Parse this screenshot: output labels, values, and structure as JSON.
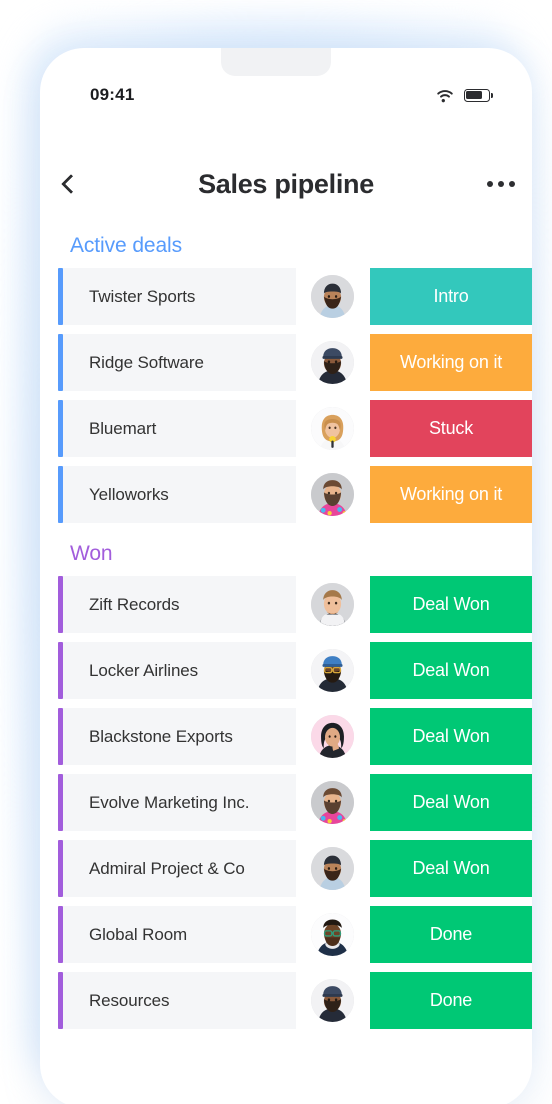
{
  "statusbar": {
    "time": "09:41",
    "wifi_icon": "wifi-icon",
    "battery_icon": "battery-icon"
  },
  "header": {
    "back_icon": "chevron-left-icon",
    "title": "Sales pipeline",
    "more_icon": "ellipsis-icon"
  },
  "colors": {
    "active_group": "#579bfc",
    "won_group": "#a25ddc",
    "status_intro": "#33c8bc",
    "status_working": "#fdab3d",
    "status_stuck": "#e2445c",
    "status_done": "#00c875",
    "row_background": "#f5f6f8",
    "text": "#333333"
  },
  "groups": [
    {
      "name": "Active deals",
      "accent": "blue",
      "rows": [
        {
          "name": "Twister Sports",
          "status": "Intro",
          "status_color": "#33c8bc",
          "avatar": "avatar-man-turban-beard"
        },
        {
          "name": "Ridge Software",
          "status": "Working on it",
          "status_color": "#fdab3d",
          "avatar": "avatar-man-cap-beard"
        },
        {
          "name": "Bluemart",
          "status": "Stuck",
          "status_color": "#e2445c",
          "avatar": "avatar-woman-blonde-mic"
        },
        {
          "name": "Yelloworks",
          "status": "Working on it",
          "status_color": "#fdab3d",
          "avatar": "avatar-man-beard-floral"
        }
      ]
    },
    {
      "name": "Won",
      "accent": "purple",
      "rows": [
        {
          "name": "Zift Records",
          "status": "Deal Won",
          "status_color": "#00c875",
          "avatar": "avatar-man-short-hair"
        },
        {
          "name": "Locker Airlines",
          "status": "Deal Won",
          "status_color": "#00c875",
          "avatar": "avatar-man-glasses-cap"
        },
        {
          "name": "Blackstone Exports",
          "status": "Deal Won",
          "status_color": "#00c875",
          "avatar": "avatar-woman-dark-hair-pink"
        },
        {
          "name": "Evolve Marketing Inc.",
          "status": "Deal Won",
          "status_color": "#00c875",
          "avatar": "avatar-man-beard-floral"
        },
        {
          "name": "Admiral Project & Co",
          "status": "Deal Won",
          "status_color": "#00c875",
          "avatar": "avatar-man-turban-beard"
        },
        {
          "name": "Global Room",
          "status": "Done",
          "status_color": "#00c875",
          "avatar": "avatar-man-glasses-navy"
        },
        {
          "name": "Resources",
          "status": "Done",
          "status_color": "#00c875",
          "avatar": "avatar-man-cap-beard"
        }
      ]
    }
  ]
}
